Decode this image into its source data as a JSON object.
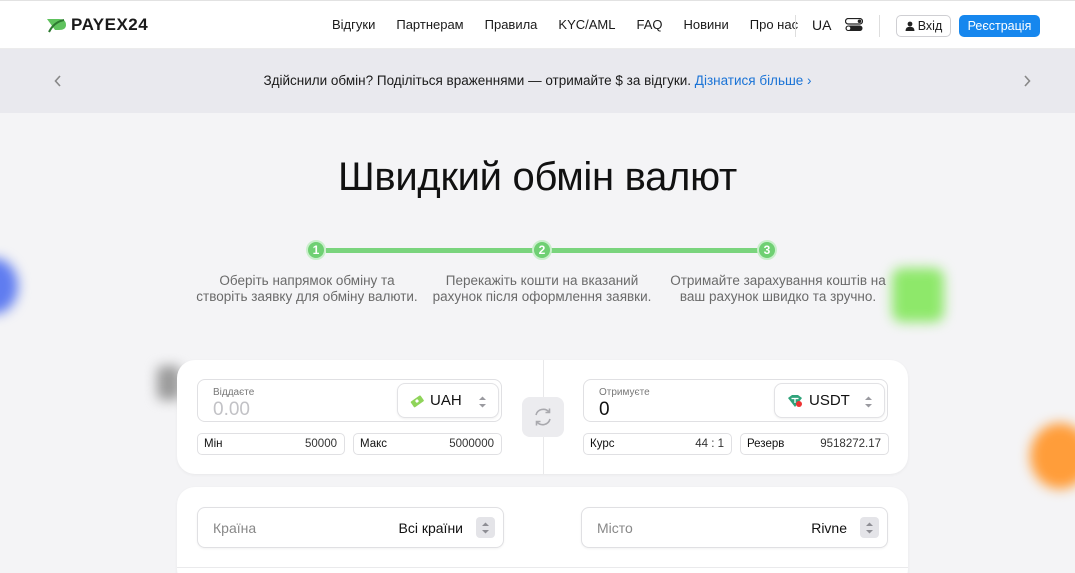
{
  "header": {
    "logo_text": "PAYEX24",
    "nav": [
      "Відгуки",
      "Партнерам",
      "Правила",
      "KYC/AML",
      "FAQ",
      "Новини",
      "Про нас"
    ],
    "lang": "UA",
    "login_label": "Вхід",
    "register_label": "Реєстрація"
  },
  "banner": {
    "text": "Здійснили обмін? Поділіться враженнями — отримайте $ за відгуки.",
    "link": "Дізнатися більше ›"
  },
  "hero": {
    "title": "Швидкий обмін валют"
  },
  "steps": [
    {
      "num": "1",
      "text": "Оберіть напрямок обміну та створіть заявку для обміну валюти."
    },
    {
      "num": "2",
      "text": "Перекажіть кошти на вказаний рахунок після оформлення заявки."
    },
    {
      "num": "3",
      "text": "Отримайте зарахування коштів на ваш рахунок швидко та зручно."
    }
  ],
  "exchange": {
    "give": {
      "label": "Віддаєте",
      "placeholder": "0.00",
      "currency": "UAH",
      "min_label": "Мін",
      "min_value": "50000",
      "max_label": "Макс",
      "max_value": "5000000"
    },
    "get": {
      "label": "Отримуєте",
      "value": "0",
      "currency": "USDT",
      "rate_label": "Курс",
      "rate_value": "44 : 1",
      "reserve_label": "Резерв",
      "reserve_value": "9518272.17"
    }
  },
  "filters": {
    "country": {
      "label": "Країна",
      "value": "Всі країни"
    },
    "city": {
      "label": "Місто",
      "value": "Rivne"
    }
  },
  "colors": {
    "accent": "#1687ee",
    "step_green": "#6fd073",
    "link": "#1a73d6"
  }
}
